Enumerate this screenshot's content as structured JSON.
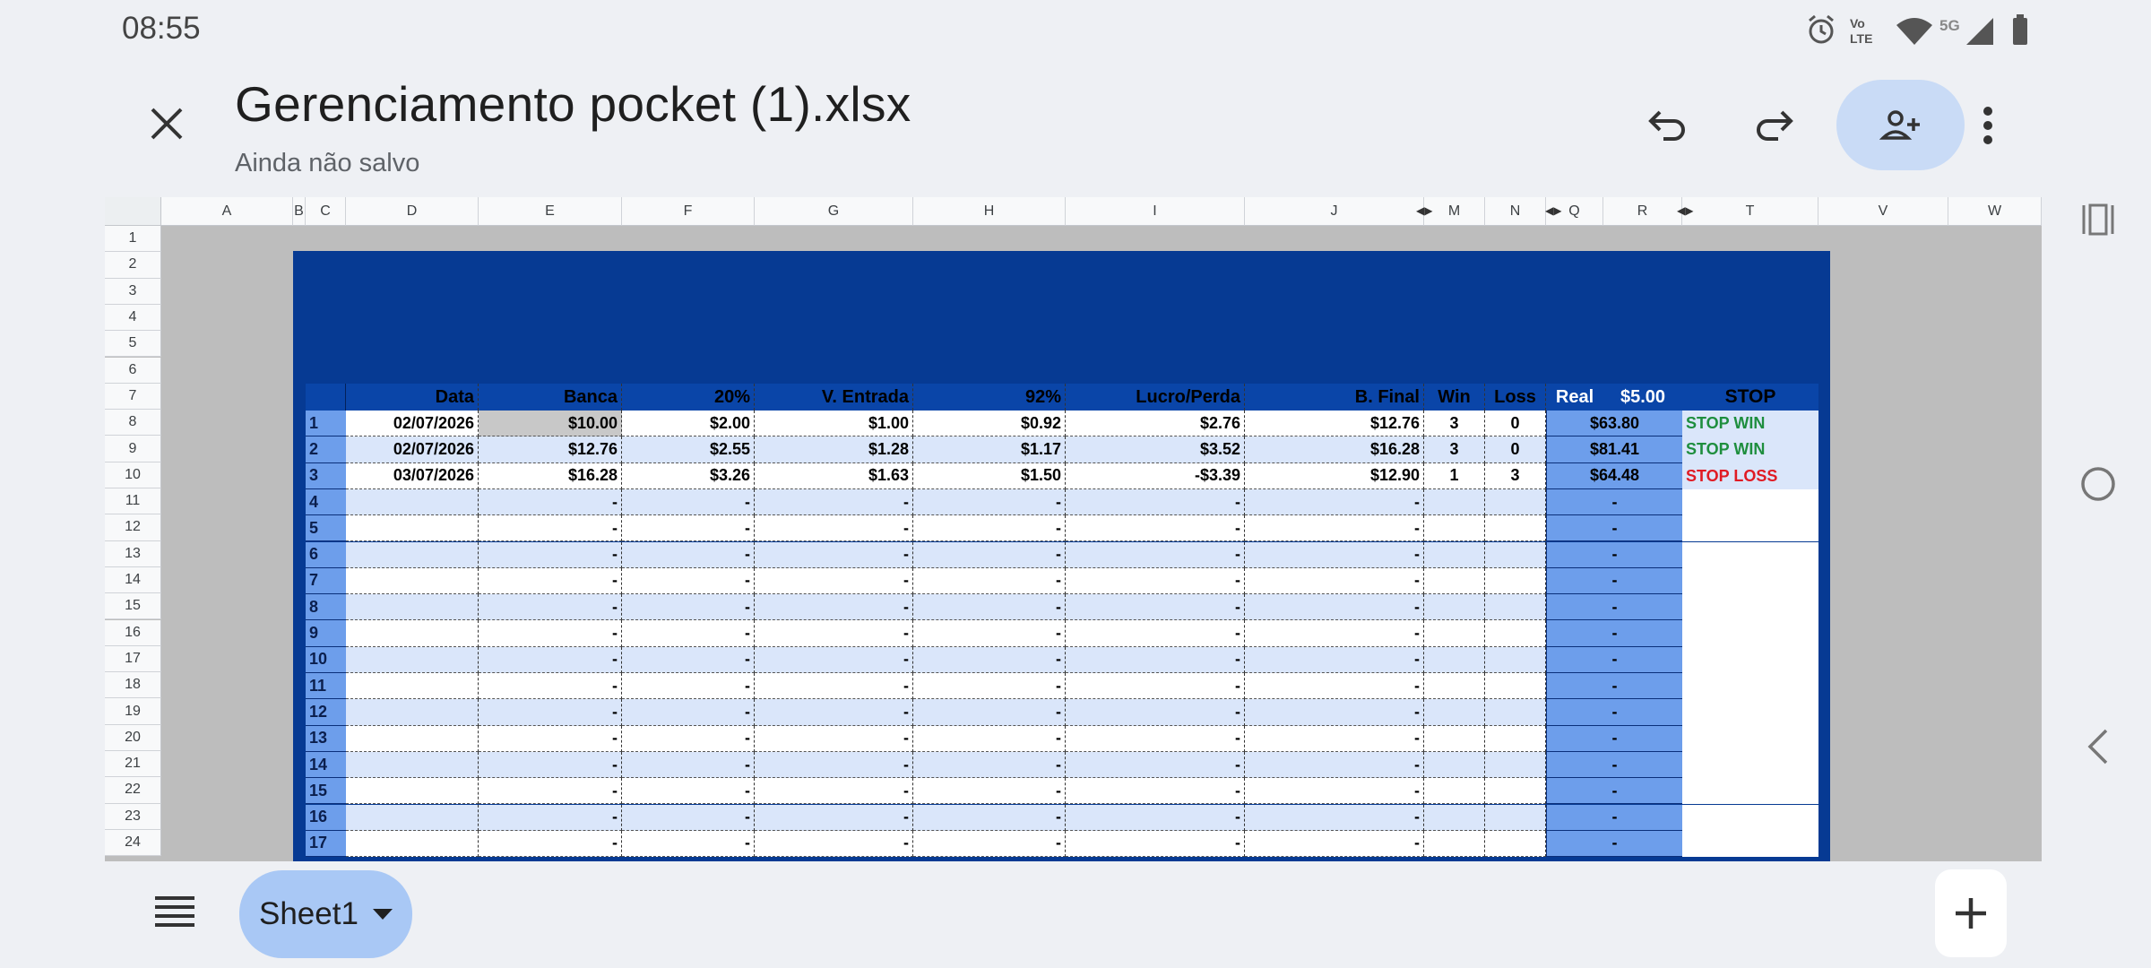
{
  "status_bar": {
    "time": "08:55",
    "network": "5G",
    "volte": "Vo LTE"
  },
  "header": {
    "title": "Gerenciamento pocket (1).xlsx",
    "subtitle": "Ainda não salvo"
  },
  "column_letters": [
    "A",
    "B",
    "C",
    "D",
    "E",
    "F",
    "G",
    "H",
    "I",
    "J",
    "M",
    "N",
    "Q",
    "R",
    "T",
    "V",
    "W"
  ],
  "row_numbers": [
    "1",
    "2",
    "3",
    "4",
    "5",
    "6",
    "7",
    "8",
    "9",
    "10",
    "11",
    "12",
    "13",
    "14",
    "15",
    "16",
    "17",
    "18",
    "19",
    "20",
    "21",
    "22",
    "23",
    "24"
  ],
  "table": {
    "headers": {
      "data": "Data",
      "banca": "Banca",
      "pct": "20%",
      "entrada": "V. Entrada",
      "payout": "92%",
      "lucro": "Lucro/Perda",
      "bfinal": "B. Final",
      "win": "Win",
      "loss": "Loss",
      "real": "Real",
      "real_value": "$5.00",
      "stop": "STOP"
    },
    "rows": [
      {
        "n": "1",
        "data": "02/07/2026",
        "banca": "$10.00",
        "pct": "$2.00",
        "entrada": "$1.00",
        "payout": "$0.92",
        "lucro": "$2.76",
        "bfinal": "$12.76",
        "win": "3",
        "loss": "0",
        "real": "$63.80",
        "stop": "STOP WIN"
      },
      {
        "n": "2",
        "data": "02/07/2026",
        "banca": "$12.76",
        "pct": "$2.55",
        "entrada": "$1.28",
        "payout": "$1.17",
        "lucro": "$3.52",
        "bfinal": "$16.28",
        "win": "3",
        "loss": "0",
        "real": "$81.41",
        "stop": "STOP WIN"
      },
      {
        "n": "3",
        "data": "03/07/2026",
        "banca": "$16.28",
        "pct": "$3.26",
        "entrada": "$1.63",
        "payout": "$1.50",
        "lucro": "-$3.39",
        "bfinal": "$12.90",
        "win": "1",
        "loss": "3",
        "real": "$64.48",
        "stop": "STOP LOSS"
      },
      {
        "n": "4",
        "data": "",
        "banca": "-",
        "pct": "-",
        "entrada": "-",
        "payout": "-",
        "lucro": "-",
        "bfinal": "-",
        "win": "",
        "loss": "",
        "real": "-",
        "stop": ""
      },
      {
        "n": "5",
        "data": "",
        "banca": "-",
        "pct": "-",
        "entrada": "-",
        "payout": "-",
        "lucro": "-",
        "bfinal": "-",
        "win": "",
        "loss": "",
        "real": "-",
        "stop": ""
      },
      {
        "n": "6",
        "data": "",
        "banca": "-",
        "pct": "-",
        "entrada": "-",
        "payout": "-",
        "lucro": "-",
        "bfinal": "-",
        "win": "",
        "loss": "",
        "real": "-",
        "stop": ""
      },
      {
        "n": "7",
        "data": "",
        "banca": "-",
        "pct": "-",
        "entrada": "-",
        "payout": "-",
        "lucro": "-",
        "bfinal": "-",
        "win": "",
        "loss": "",
        "real": "-",
        "stop": ""
      },
      {
        "n": "8",
        "data": "",
        "banca": "-",
        "pct": "-",
        "entrada": "-",
        "payout": "-",
        "lucro": "-",
        "bfinal": "-",
        "win": "",
        "loss": "",
        "real": "-",
        "stop": ""
      },
      {
        "n": "9",
        "data": "",
        "banca": "-",
        "pct": "-",
        "entrada": "-",
        "payout": "-",
        "lucro": "-",
        "bfinal": "-",
        "win": "",
        "loss": "",
        "real": "-",
        "stop": ""
      },
      {
        "n": "10",
        "data": "",
        "banca": "-",
        "pct": "-",
        "entrada": "-",
        "payout": "-",
        "lucro": "-",
        "bfinal": "-",
        "win": "",
        "loss": "",
        "real": "-",
        "stop": ""
      },
      {
        "n": "11",
        "data": "",
        "banca": "-",
        "pct": "-",
        "entrada": "-",
        "payout": "-",
        "lucro": "-",
        "bfinal": "-",
        "win": "",
        "loss": "",
        "real": "-",
        "stop": ""
      },
      {
        "n": "12",
        "data": "",
        "banca": "-",
        "pct": "-",
        "entrada": "-",
        "payout": "-",
        "lucro": "-",
        "bfinal": "-",
        "win": "",
        "loss": "",
        "real": "-",
        "stop": ""
      },
      {
        "n": "13",
        "data": "",
        "banca": "-",
        "pct": "-",
        "entrada": "-",
        "payout": "-",
        "lucro": "-",
        "bfinal": "-",
        "win": "",
        "loss": "",
        "real": "-",
        "stop": ""
      },
      {
        "n": "14",
        "data": "",
        "banca": "-",
        "pct": "-",
        "entrada": "-",
        "payout": "-",
        "lucro": "-",
        "bfinal": "-",
        "win": "",
        "loss": "",
        "real": "-",
        "stop": ""
      },
      {
        "n": "15",
        "data": "",
        "banca": "-",
        "pct": "-",
        "entrada": "-",
        "payout": "-",
        "lucro": "-",
        "bfinal": "-",
        "win": "",
        "loss": "",
        "real": "-",
        "stop": ""
      },
      {
        "n": "16",
        "data": "",
        "banca": "-",
        "pct": "-",
        "entrada": "-",
        "payout": "-",
        "lucro": "-",
        "bfinal": "-",
        "win": "",
        "loss": "",
        "real": "-",
        "stop": ""
      },
      {
        "n": "17",
        "data": "",
        "banca": "-",
        "pct": "-",
        "entrada": "-",
        "payout": "-",
        "lucro": "-",
        "bfinal": "-",
        "win": "",
        "loss": "",
        "real": "-",
        "stop": ""
      }
    ]
  },
  "bottom_bar": {
    "sheet_tab": "Sheet1"
  },
  "colors": {
    "frame": "#063a93",
    "real_column": "#6d9eeb",
    "band": "#dae6fa",
    "stop_win": "#1e8e3e",
    "stop_loss": "#e01b24",
    "accent": "#c9dbf6"
  }
}
